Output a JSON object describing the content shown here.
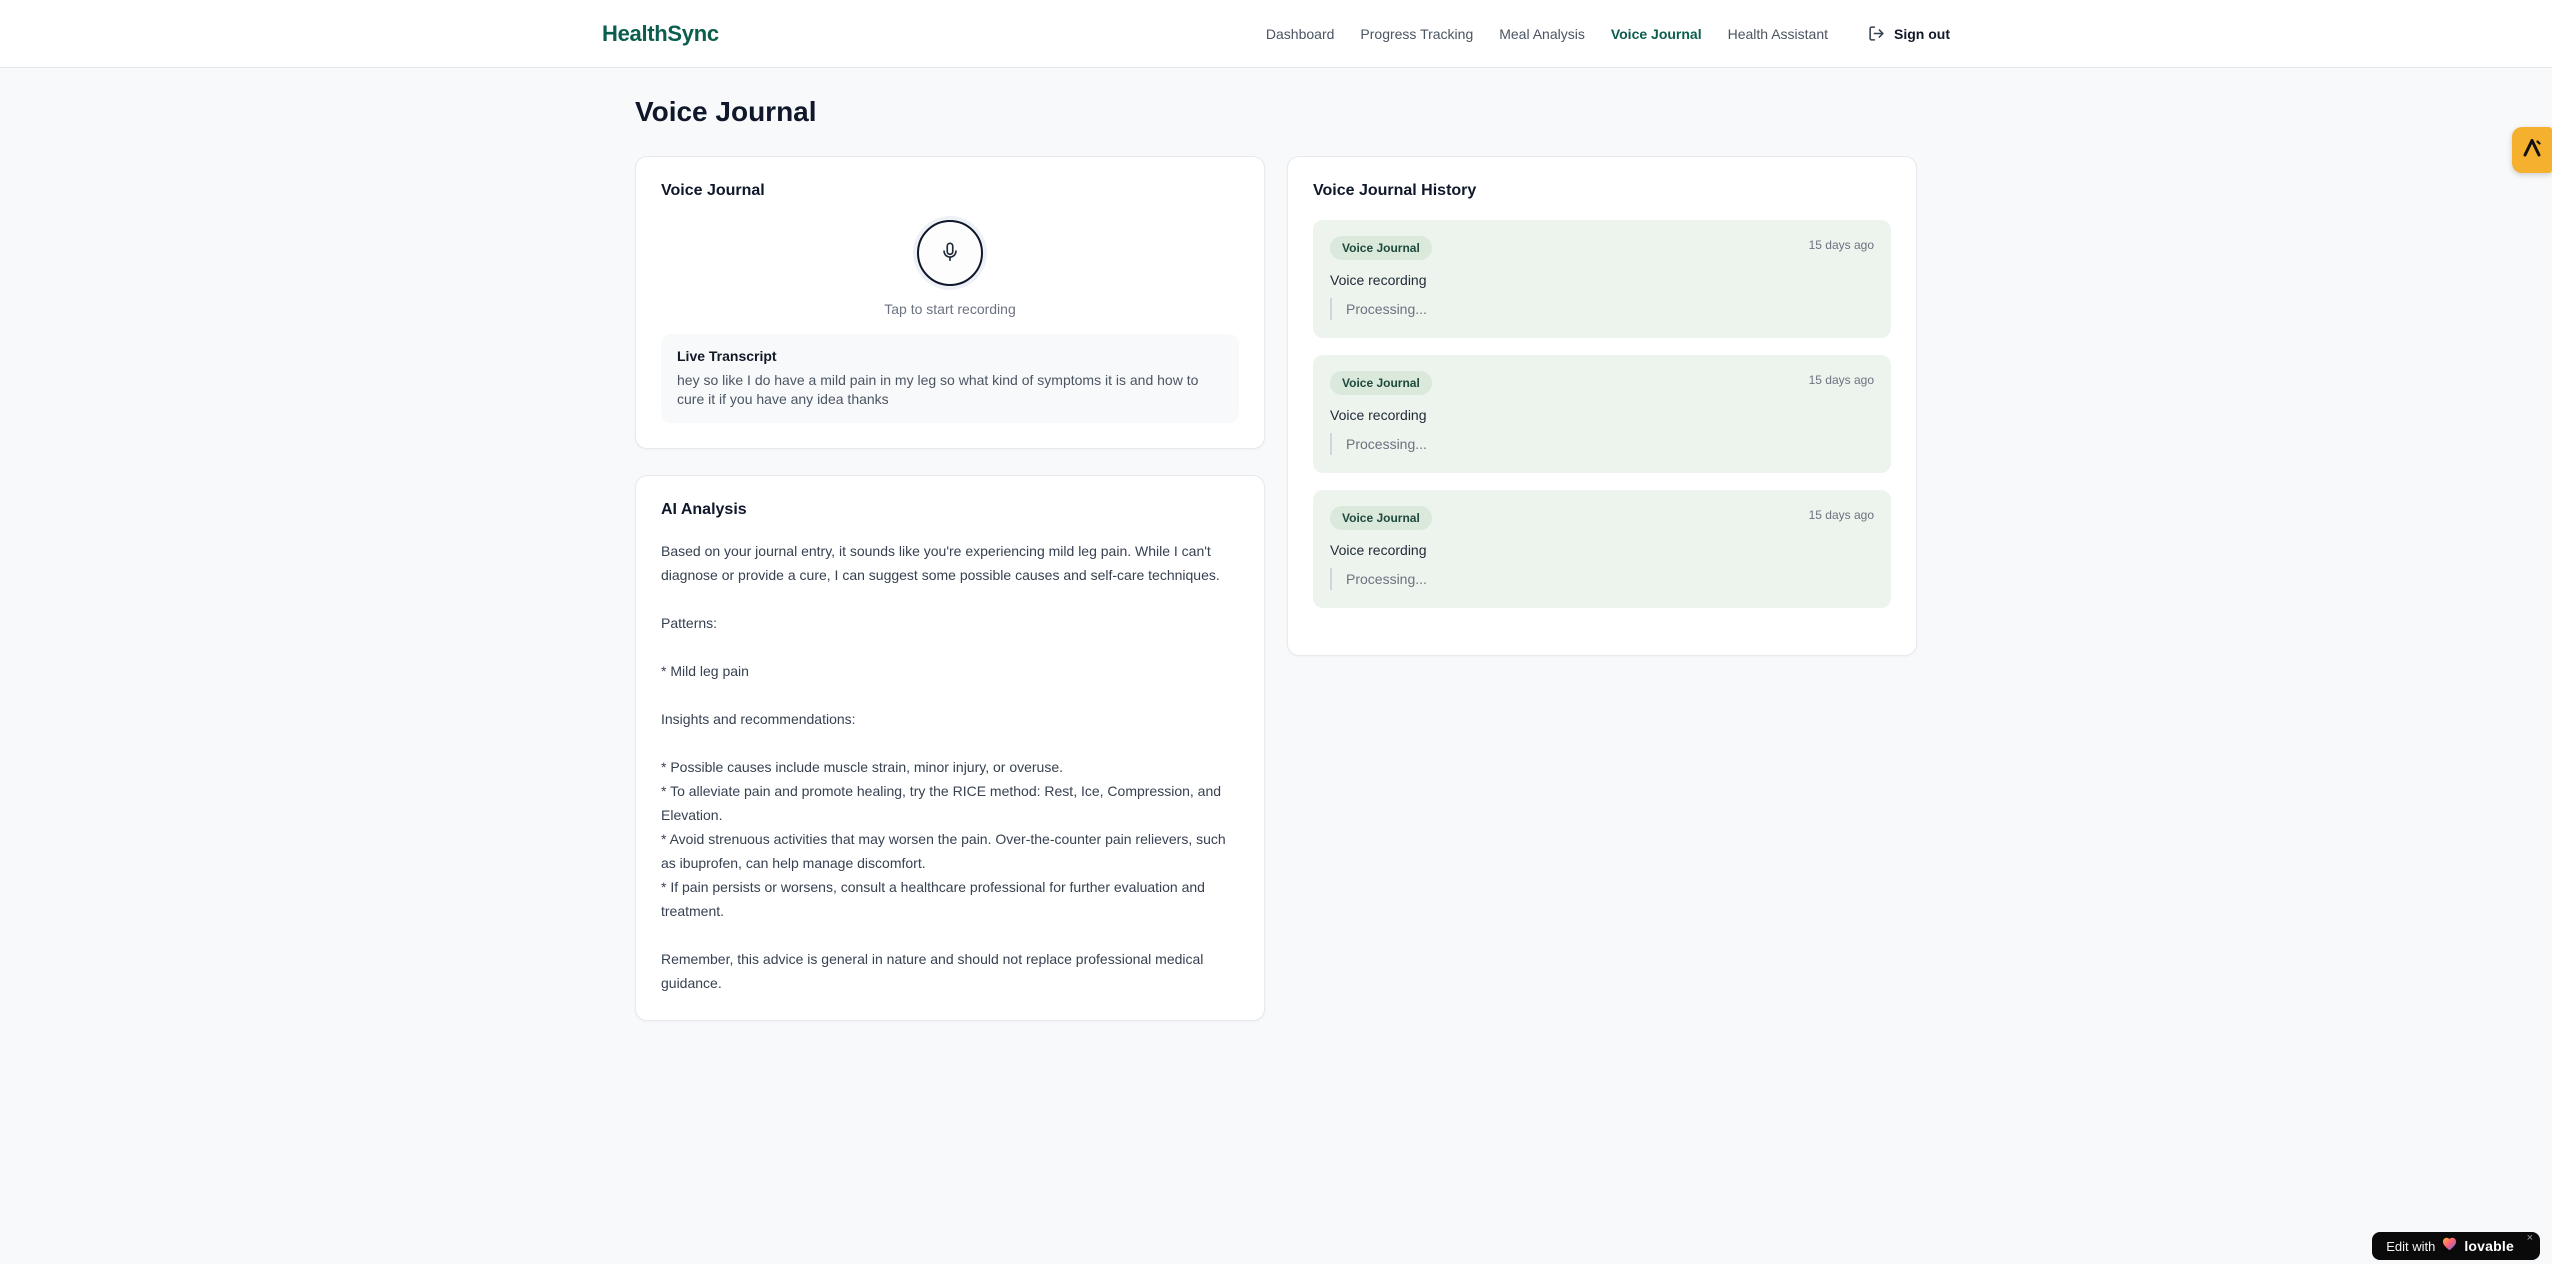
{
  "header": {
    "brand": "HealthSync",
    "nav": [
      {
        "label": "Dashboard",
        "active": false
      },
      {
        "label": "Progress Tracking",
        "active": false
      },
      {
        "label": "Meal Analysis",
        "active": false
      },
      {
        "label": "Voice Journal",
        "active": true
      },
      {
        "label": "Health Assistant",
        "active": false
      }
    ],
    "sign_out_label": "Sign out",
    "sign_out_icon": "logout-icon"
  },
  "page": {
    "title": "Voice Journal"
  },
  "recorder": {
    "card_title": "Voice Journal",
    "mic_icon": "microphone-icon",
    "tap_hint": "Tap to start recording",
    "transcript_heading": "Live Transcript",
    "transcript_text": "hey so like I do have a mild pain in my leg so what kind of symptoms it is and how to cure it if you have any idea thanks"
  },
  "analysis": {
    "card_title": "AI Analysis",
    "paragraphs": [
      "Based on your journal entry, it sounds like you're experiencing mild leg pain. While I can't diagnose or provide a cure, I can suggest some possible causes and self-care techniques.",
      "Patterns:",
      "* Mild leg pain",
      "Insights and recommendations:",
      "* Possible causes include muscle strain, minor injury, or overuse.\n* To alleviate pain and promote healing, try the RICE method: Rest, Ice, Compression, and Elevation.\n* Avoid strenuous activities that may worsen the pain. Over-the-counter pain relievers, such as ibuprofen, can help manage discomfort.\n* If pain persists or worsens, consult a healthcare professional for further evaluation and treatment.",
      "Remember, this advice is general in nature and should not replace professional medical guidance."
    ]
  },
  "history": {
    "card_title": "Voice Journal History",
    "entries": [
      {
        "badge": "Voice Journal",
        "time": "15 days ago",
        "title": "Voice recording",
        "status": "Processing..."
      },
      {
        "badge": "Voice Journal",
        "time": "15 days ago",
        "title": "Voice recording",
        "status": "Processing..."
      },
      {
        "badge": "Voice Journal",
        "time": "15 days ago",
        "title": "Voice recording",
        "status": "Processing..."
      }
    ]
  },
  "overlays": {
    "side_tab_icon": "amber-peak-logo-icon",
    "edit_badge": {
      "prefix": "Edit with",
      "brand": "lovable",
      "heart_icon": "gradient-heart-icon",
      "close": "×"
    }
  },
  "colors": {
    "accent_green": "#0b5d4e",
    "page_bg": "#f8f9fb",
    "entry_bg": "#ecf4ed",
    "badge_bg": "#dbe8dc",
    "badge_text": "#1d4a3c",
    "amber_tab": "#f5b02e",
    "mic_ring": "#0f172a"
  }
}
